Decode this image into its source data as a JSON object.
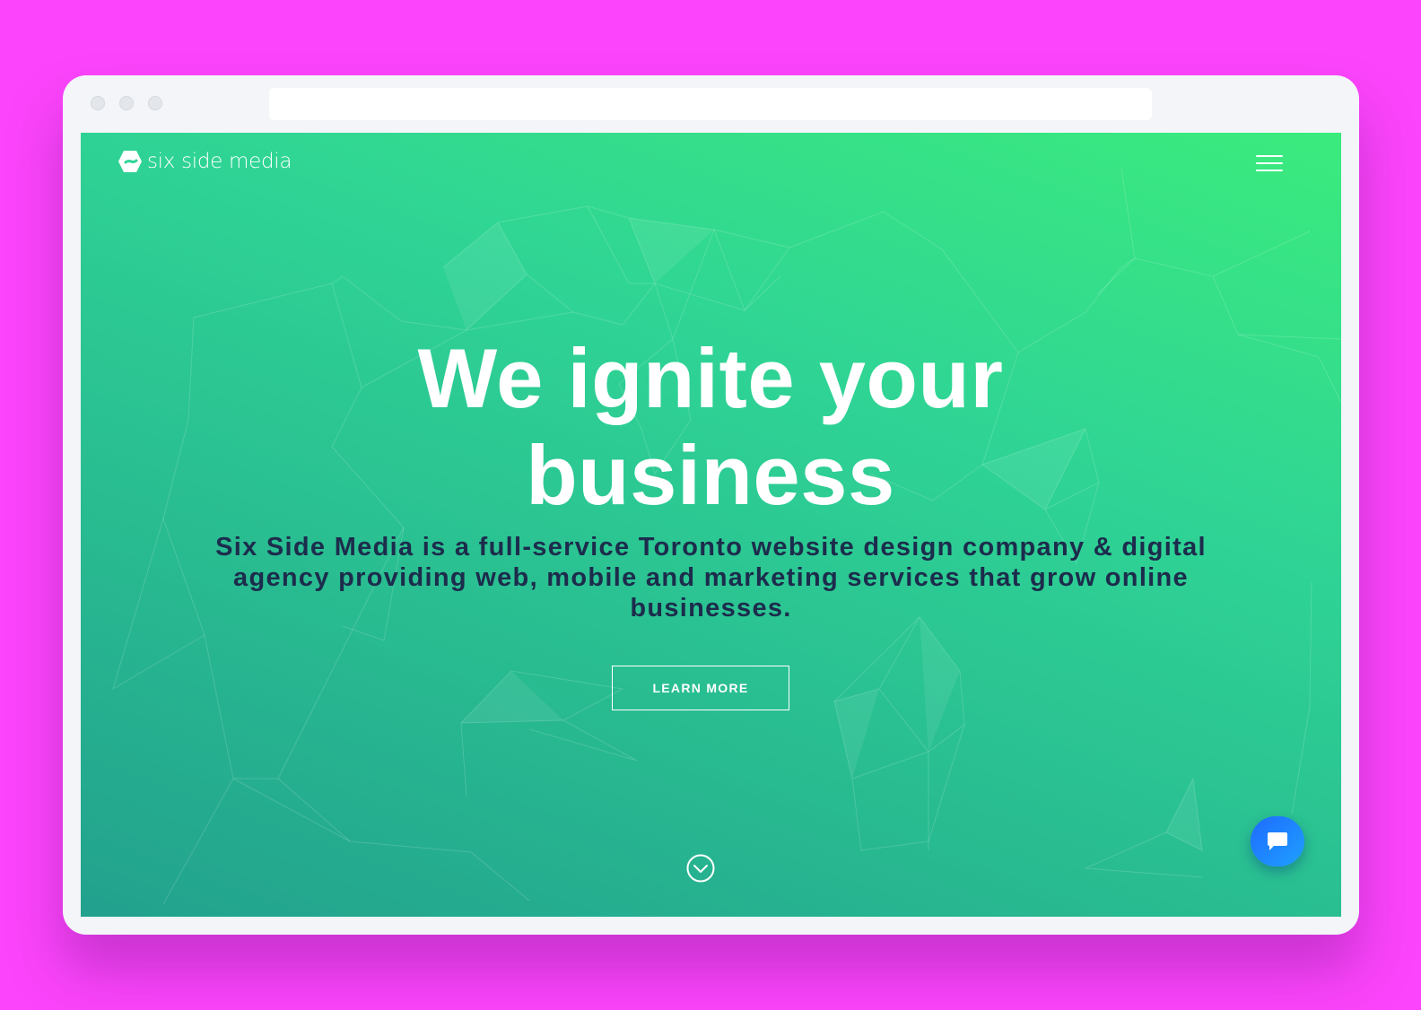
{
  "browser": {
    "window_controls": [
      "dot-1",
      "dot-2",
      "dot-3"
    ],
    "address_value": ""
  },
  "header": {
    "logo_text": "six side media",
    "logo_icon": "six-side-logo-icon",
    "menu_icon": "hamburger-menu-icon"
  },
  "hero": {
    "title_line1": "We ignite your",
    "title_line2": "business",
    "subtitle": "Six Side Media is a full-service Toronto website design company & digital agency providing web, mobile and marketing services that grow online businesses.",
    "cta_label": "LEARN MORE",
    "scroll_icon": "chevron-down-circle-icon"
  },
  "chat": {
    "icon": "chat-bubble-icon"
  },
  "colors": {
    "page_background": "#fb44fb",
    "gradient_top_right": "#3beb7d",
    "gradient_bottom_left": "#22a18e",
    "subtitle_text": "#1c2c4c",
    "chat_button": "#1f6bff"
  }
}
